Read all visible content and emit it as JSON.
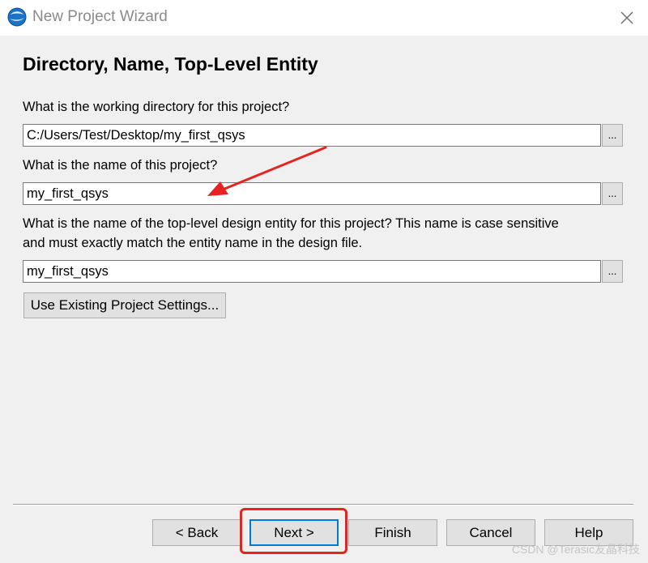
{
  "window": {
    "title": "New Project Wizard",
    "heading": "Directory, Name, Top-Level Entity"
  },
  "form": {
    "directory_prompt": "What is the working directory for this project?",
    "directory_value": "C:/Users/Test/Desktop/my_first_qsys",
    "name_prompt": "What is the name of this project?",
    "name_value": "my_first_qsys",
    "entity_prompt_line1": "What is the name of the top-level design entity for this project? This name is case sensitive",
    "entity_prompt_line2": "and must exactly match the entity name in the design file.",
    "entity_value": "my_first_qsys",
    "browse_label": "...",
    "existing_settings_label": "Use Existing Project Settings..."
  },
  "footer": {
    "back_label": "< Back",
    "next_label": "Next >",
    "finish_label": "Finish",
    "cancel_label": "Cancel",
    "help_label": "Help"
  },
  "watermark": "CSDN @Terasic友晶科技",
  "icons": {
    "app": "quartus-globe-icon",
    "close": "close-icon"
  },
  "colors": {
    "annotation": "#e8221f",
    "default_button_border": "#0078d7"
  }
}
